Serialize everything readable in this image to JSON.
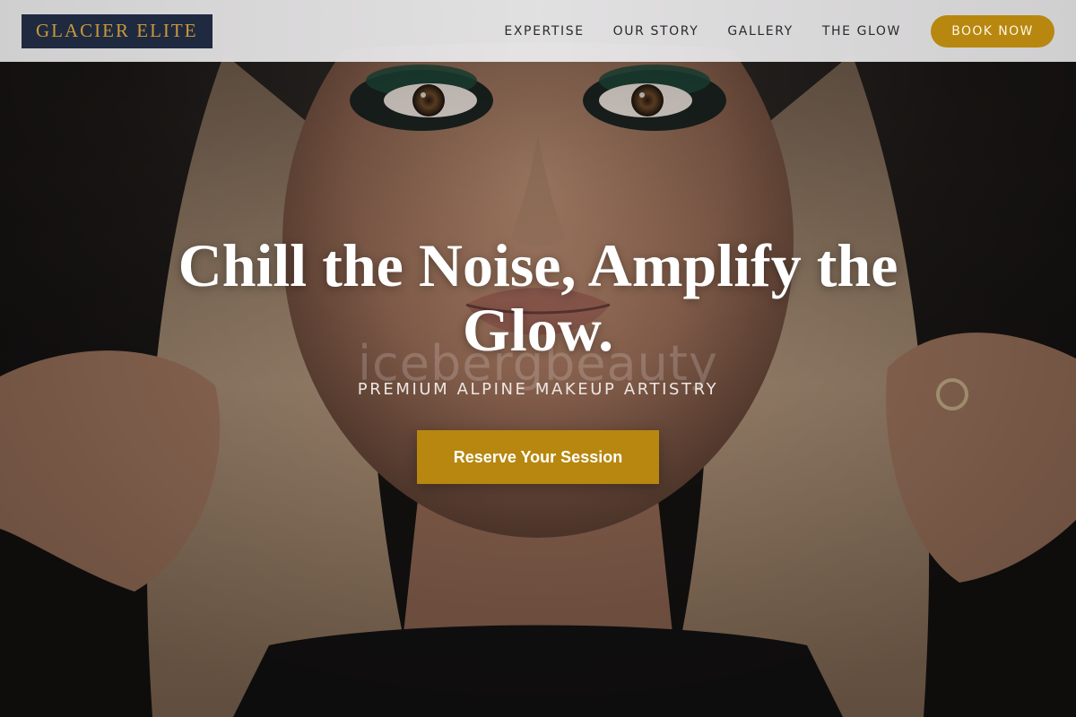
{
  "brand": {
    "logo_text": "GLACIER ELITE"
  },
  "nav": {
    "items": [
      {
        "label": "EXPERTISE"
      },
      {
        "label": "OUR STORY"
      },
      {
        "label": "GALLERY"
      },
      {
        "label": "THE GLOW"
      }
    ],
    "book_label": "BOOK NOW"
  },
  "hero": {
    "title_line1": "Chill the Noise, Amplify the",
    "title_line2": "Glow.",
    "watermark": "icebergbeauty",
    "subtitle": "PREMIUM ALPINE MAKEUP ARTISTRY",
    "cta_label": "Reserve Your Session",
    "image_subject": "portrait-photo"
  },
  "colors": {
    "accent_gold": "#b8870f",
    "logo_bg": "#1f2a40",
    "logo_text": "#c9993a",
    "header_bg": "#e3e2e3",
    "title_text": "#ffffff"
  }
}
